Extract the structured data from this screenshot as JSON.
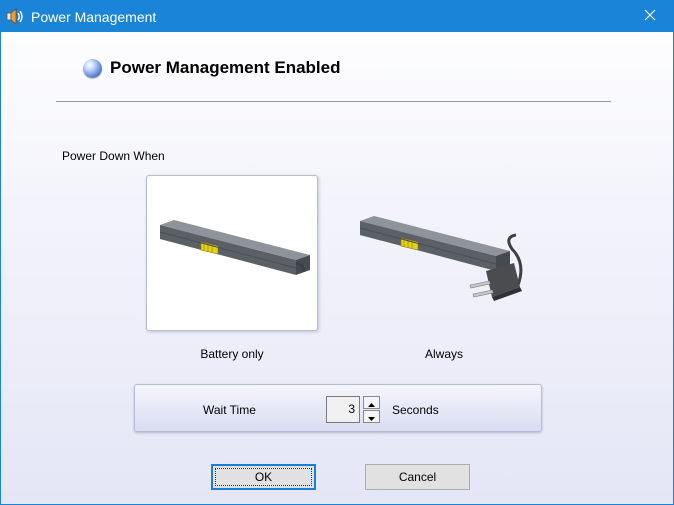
{
  "window": {
    "title": "Power Management",
    "app_icon": "speaker-icon",
    "close_icon": "close-icon"
  },
  "header": {
    "status_icon": "blue-orb-icon",
    "title": "Power Management Enabled"
  },
  "power_down": {
    "label": "Power Down When",
    "options": [
      {
        "label": "Battery only",
        "icon": "battery-icon",
        "selected": true
      },
      {
        "label": "Always",
        "icon": "battery-with-plug-icon",
        "selected": false
      }
    ]
  },
  "wait_time": {
    "label": "Wait Time",
    "value": "3",
    "unit": "Seconds"
  },
  "buttons": {
    "ok": "OK",
    "cancel": "Cancel"
  },
  "colors": {
    "titlebar": "#1a84d8",
    "focus_border": "#1a7fd2"
  }
}
